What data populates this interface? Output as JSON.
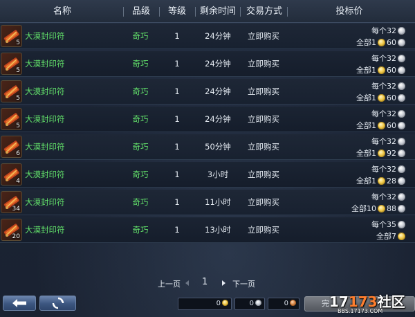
{
  "header": {
    "columns": [
      "名称",
      "品级",
      "等级",
      "剩余时间",
      "交易方式",
      "投标价"
    ]
  },
  "rows": [
    {
      "qty": "5",
      "name": "大漠封印符",
      "grade": "奇巧",
      "level": "1",
      "time": "24分钟",
      "trade": "立即购买",
      "per_label": "每个",
      "per_value": "32",
      "total_label": "全部",
      "total_gold": "1",
      "total_silver": "60"
    },
    {
      "qty": "5",
      "name": "大漠封印符",
      "grade": "奇巧",
      "level": "1",
      "time": "24分钟",
      "trade": "立即购买",
      "per_label": "每个",
      "per_value": "32",
      "total_label": "全部",
      "total_gold": "1",
      "total_silver": "60"
    },
    {
      "qty": "5",
      "name": "大漠封印符",
      "grade": "奇巧",
      "level": "1",
      "time": "24分钟",
      "trade": "立即购买",
      "per_label": "每个",
      "per_value": "32",
      "total_label": "全部",
      "total_gold": "1",
      "total_silver": "60"
    },
    {
      "qty": "5",
      "name": "大漠封印符",
      "grade": "奇巧",
      "level": "1",
      "time": "24分钟",
      "trade": "立即购买",
      "per_label": "每个",
      "per_value": "32",
      "total_label": "全部",
      "total_gold": "1",
      "total_silver": "60"
    },
    {
      "qty": "6",
      "name": "大漠封印符",
      "grade": "奇巧",
      "level": "1",
      "time": "50分钟",
      "trade": "立即购买",
      "per_label": "每个",
      "per_value": "32",
      "total_label": "全部",
      "total_gold": "1",
      "total_silver": "92"
    },
    {
      "qty": "4",
      "name": "大漠封印符",
      "grade": "奇巧",
      "level": "1",
      "time": "3小时",
      "trade": "立即购买",
      "per_label": "每个",
      "per_value": "32",
      "total_label": "全部",
      "total_gold": "1",
      "total_silver": "28"
    },
    {
      "qty": "34",
      "name": "大漠封印符",
      "grade": "奇巧",
      "level": "1",
      "time": "11小时",
      "trade": "立即购买",
      "per_label": "每个",
      "per_value": "32",
      "total_label": "全部",
      "total_gold": "10",
      "total_silver": "88"
    },
    {
      "qty": "20",
      "name": "大漠封印符",
      "grade": "奇巧",
      "level": "1",
      "time": "13小时",
      "trade": "立即购买",
      "per_label": "每个",
      "per_value": "35",
      "total_label": "全部",
      "total_gold": "7",
      "total_silver": ""
    }
  ],
  "pagination": {
    "prev_label": "上一页",
    "page": "1",
    "next_label": "下一页"
  },
  "bottom": {
    "gold_value": "0",
    "silver_value": "0",
    "copper_value": "0",
    "buy_label": "完"
  },
  "watermark": {
    "brand_a": "17",
    "brand_b": "173",
    "brand_c": "社区",
    "url": "BBS.17173.COM"
  },
  "icons": {
    "back_button": "back-arrow-icon",
    "refresh_button": "refresh-icon",
    "item_icon": "scroll-talisman-icon"
  },
  "colors": {
    "green_text": "#62e06a",
    "gold_coin": "#f0c94a",
    "silver_coin": "#c8ccd4",
    "copper_coin": "#d98a4a",
    "button_blue": "#3c5680",
    "watermark_orange": "#ff7e2e"
  }
}
